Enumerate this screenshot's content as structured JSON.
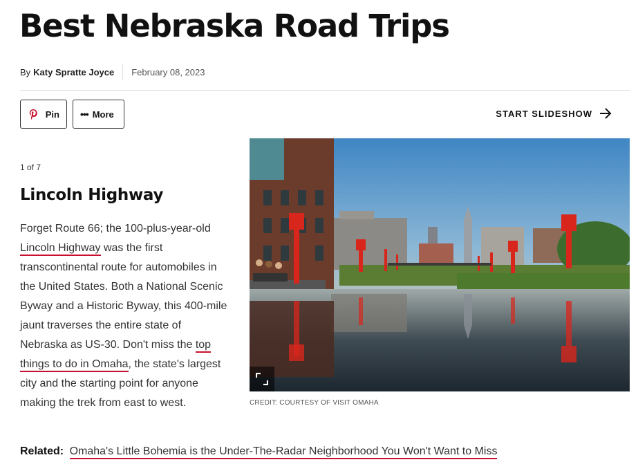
{
  "article": {
    "title": "Best Nebraska Road Trips",
    "by": "By",
    "author": "Katy Spratte Joyce",
    "date": "February 08, 2023"
  },
  "toolbar": {
    "pin_label": "Pin",
    "more_label": "More",
    "slideshow_label": "START SLIDESHOW"
  },
  "icons": {
    "pin": "pinterest-icon",
    "more": "more-dots-icon",
    "slideshow": "arrow-right-icon",
    "expand": "expand-icon"
  },
  "colors": {
    "link_underline": "#c8102e",
    "pinterest": "#c8102e",
    "text": "#333333"
  },
  "slide": {
    "counter": "1 of 7",
    "title": "Lincoln Highway",
    "text_1": "Forget Route 66; the 100-plus-year-old ",
    "link_1": "Lincoln Highway",
    "text_2": " was the first transcontinental route for automobiles in the United States. Both a National Scenic Byway and a Historic Byway, this 400-mile jaunt traverses the entire state of Nebraska as US-30. Don't miss the ",
    "link_2": "top things to do in Omaha",
    "text_3": ", the state's largest city and the starting point for anyone making the trek from east to west.",
    "image_credit": "CREDIT: COURTESY OF VISIT OMAHA"
  },
  "related": {
    "label": "Related:",
    "link": "Omaha's Little Bohemia is the Under-The-Radar Neighborhood You Won't Want to Miss"
  }
}
